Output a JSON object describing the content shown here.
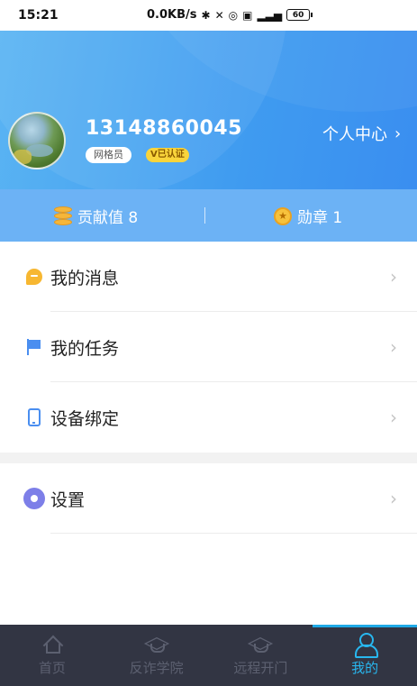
{
  "status_bar": {
    "time": "15:21",
    "network_speed": "0.0KB/s",
    "icons": [
      "bluetooth-icon",
      "mute-icon",
      "alarm-icon",
      "hd-icon",
      "4g-signal-icon"
    ],
    "battery": "60"
  },
  "profile": {
    "phone": "13148860045",
    "role": "网格员",
    "verified": "V已认证",
    "center_link": "个人中心",
    "center_chevron": "›"
  },
  "stats": {
    "contribution": "贡献值 8",
    "medals": "勋章 1",
    "medal_icon_glyph": "★"
  },
  "menu": {
    "items": [
      {
        "label": "我的消息",
        "icon": "message-icon",
        "color": "#f7b731"
      },
      {
        "label": "我的任务",
        "icon": "flag-icon",
        "color": "#4a8ef0"
      },
      {
        "label": "设备绑定",
        "icon": "phone-icon",
        "color": "#4a8ef0"
      }
    ],
    "settings": {
      "label": "设置",
      "icon": "gear-icon",
      "color": "#7d7fe8"
    },
    "chevron": "›"
  },
  "tabbar": {
    "tabs": [
      {
        "label": "首页",
        "icon": "home-icon"
      },
      {
        "label": "反诈学院",
        "icon": "graduation-cap-icon"
      },
      {
        "label": "远程开门",
        "icon": "graduation-cap-icon"
      },
      {
        "label": "我的",
        "icon": "user-icon"
      }
    ],
    "active_index": 3,
    "active_color": "#28b7ef",
    "background": "#323543"
  },
  "colors": {
    "header_blue": "#3f9bf0",
    "stats_blue": "#6cb2f5",
    "verified_yellow": "#f9d43b"
  }
}
